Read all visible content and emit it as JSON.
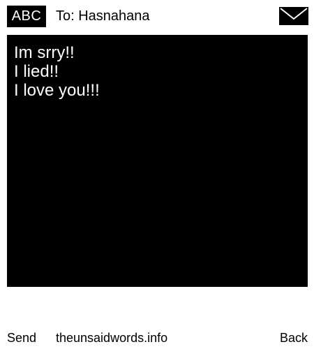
{
  "header": {
    "input_mode_label": "ABC",
    "recipient_text": "To: Hasnahana",
    "icon": "envelope-icon"
  },
  "message": {
    "lines": [
      "Im srry!!",
      "I lied!!",
      "I love you!!!"
    ]
  },
  "footer": {
    "send_label": "Send",
    "site_label": "theunsaidwords.info",
    "back_label": "Back"
  },
  "colors": {
    "background": "#ffffff",
    "message_background": "#000000",
    "message_text": "#ffffff",
    "badge_background": "#000000"
  }
}
